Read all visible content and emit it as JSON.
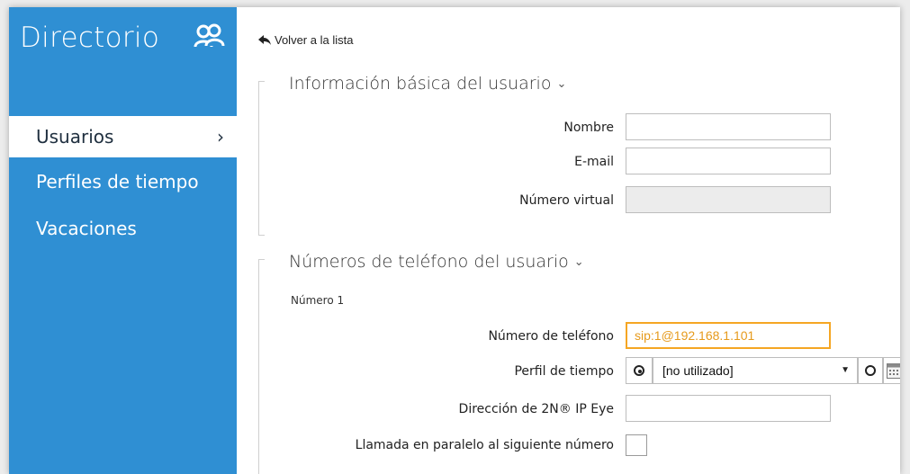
{
  "sidebar": {
    "title": "Directorio",
    "icon": "users-icon",
    "items": [
      {
        "label": "Usuarios",
        "active": true,
        "chevron": "›"
      },
      {
        "label": "Perfiles de tiempo",
        "active": false
      },
      {
        "label": "Vacaciones",
        "active": false
      }
    ]
  },
  "main": {
    "back_link": "Volver a la lista",
    "basic_section": {
      "title": "Información básica del usuario",
      "chevron": "⌄",
      "fields": [
        {
          "label": "Nombre",
          "value": ""
        },
        {
          "label": "E-mail",
          "value": ""
        },
        {
          "label": "Número virtual",
          "value": "",
          "disabled": true
        }
      ]
    },
    "phone_section": {
      "title": "Números de teléfono del usuario",
      "chevron": "⌄",
      "number_label": "Número 1",
      "phone_label": "Número de teléfono",
      "phone_value": "sip:1@192.168.1.101",
      "profile_label": "Perfil de tiempo",
      "profile_value": "[no utilizado]",
      "profile_arrow": "▼",
      "ipeye_label": "Dirección de 2N® IP Eye",
      "ipeye_value": "",
      "parallel_label": "Llamada en paralelo al siguiente número",
      "parallel_checked": false
    }
  },
  "colors": {
    "sidebar_bg": "#2f8fd3",
    "highlight_border": "#f5a623",
    "highlight_text": "#e69a1c"
  }
}
